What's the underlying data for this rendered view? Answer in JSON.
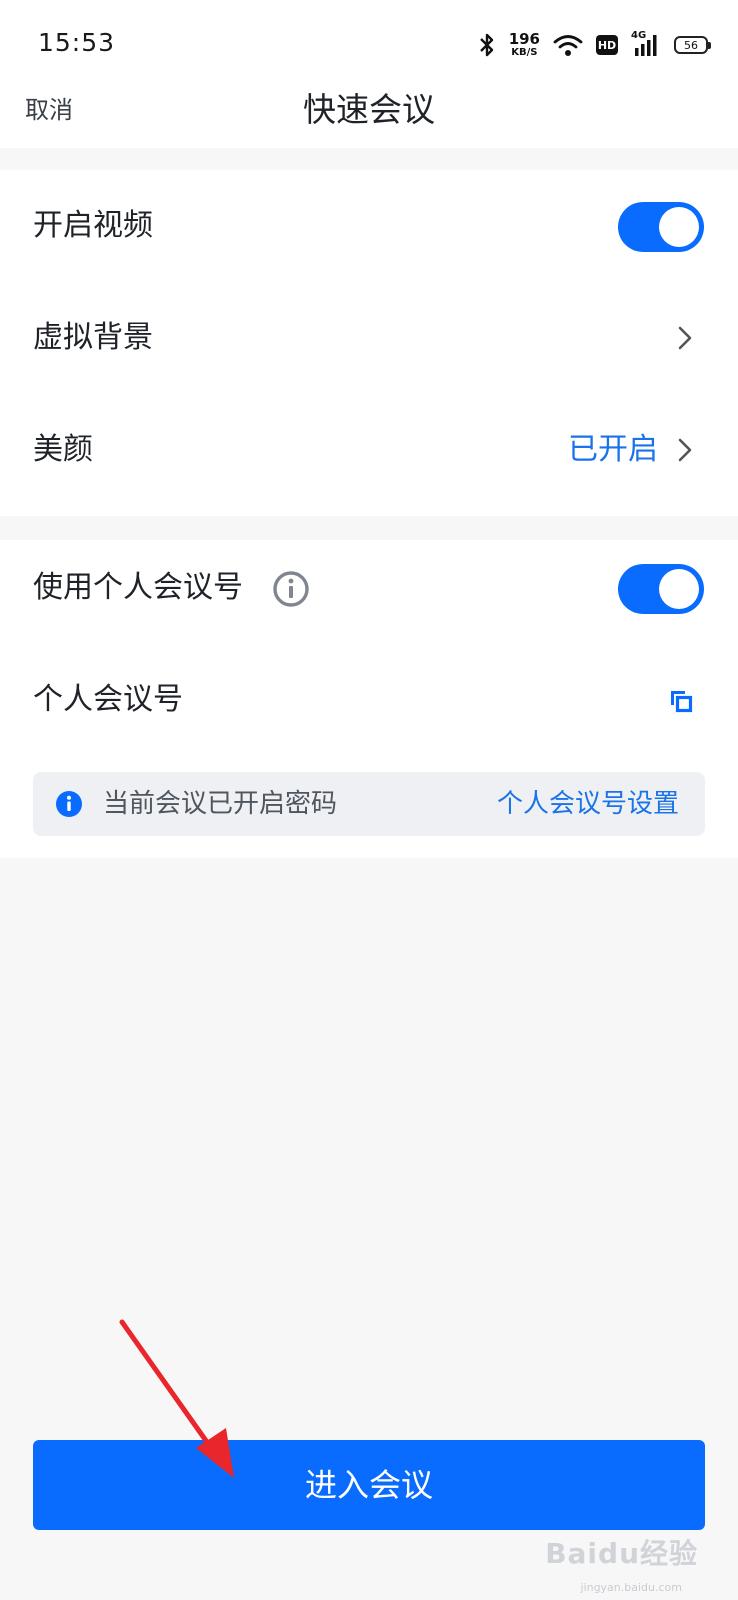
{
  "status_bar": {
    "time": "15:53",
    "net_speed_value": "196",
    "net_speed_unit": "KB/S",
    "hd_label": "HD",
    "signal_label": "4G",
    "battery_level": "56",
    "icons": [
      "bluetooth-icon",
      "wifi-icon",
      "signal-icon",
      "battery-icon"
    ]
  },
  "header": {
    "cancel_label": "取消",
    "title": "快速会议"
  },
  "settings": {
    "video": {
      "label": "开启视频",
      "enabled": true
    },
    "virtual_background": {
      "label": "虚拟背景"
    },
    "beauty": {
      "label": "美颜",
      "value": "已开启"
    },
    "personal_meeting_id_toggle": {
      "label": "使用个人会议号",
      "enabled": true
    },
    "personal_meeting_id": {
      "label": "个人会议号"
    }
  },
  "notice": {
    "text": "当前会议已开启密码",
    "link": "个人会议号设置"
  },
  "enter_button_label": "进入会议",
  "watermark": {
    "text": "Baidu经验",
    "sub": "jingyan.baidu.com"
  },
  "colors": {
    "accent": "#0a6cff",
    "link": "#1a73e8",
    "arrow": "#e8262b"
  }
}
